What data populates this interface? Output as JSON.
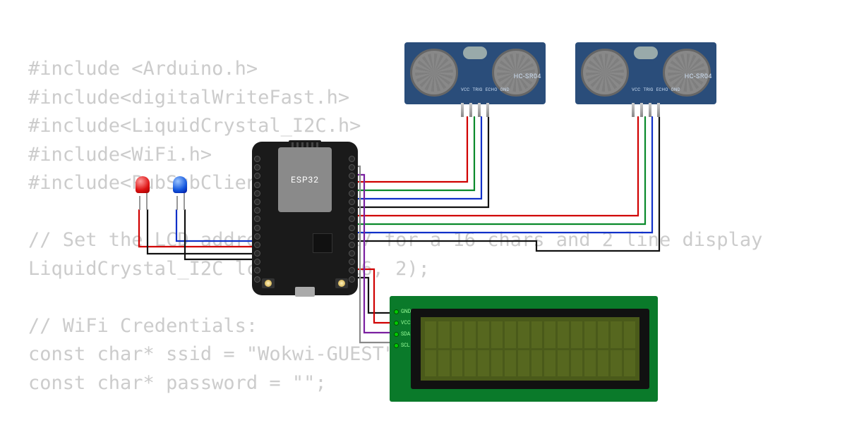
{
  "code": {
    "lines": [
      "#include <Arduino.h>",
      "#include<digitalWriteFast.h>",
      "#include<LiquidCrystal_I2C.h>",
      "#include<WiFi.h>",
      "#include<PubSubClient.h>",
      "",
      "// Set the LCD address to 0x27 for a 16 chars and 2 line display",
      "LiquidCrystal_I2C lcd(0x27, 16, 2);",
      "",
      "// WiFi Credentials:",
      "const char* ssid = \"Wokwi-GUEST\";",
      "const char* password = \"\";"
    ]
  },
  "components": {
    "mcu": {
      "label": "ESP32"
    },
    "ultrasonic": {
      "model": "HC-SR04",
      "pin_labels": [
        "VCC",
        "TRIG",
        "ECHO",
        "GND"
      ]
    },
    "lcd": {
      "i2c_pins": [
        "GND",
        "VCC",
        "SDA",
        "SCL"
      ]
    },
    "leds": {
      "red": "red",
      "blue": "blue"
    }
  },
  "wire_colors": {
    "vcc": "#d00000",
    "gnd": "#111111",
    "sda": "#7a1fa0",
    "scl": "#8a8a8a",
    "trig1": "#0a8a2a",
    "echo1": "#1030c8",
    "trig2": "#0a8a2a",
    "echo2": "#1030c8",
    "led_red": "#d00000",
    "led_blue": "#1030c8",
    "led_gnd": "#111111"
  }
}
